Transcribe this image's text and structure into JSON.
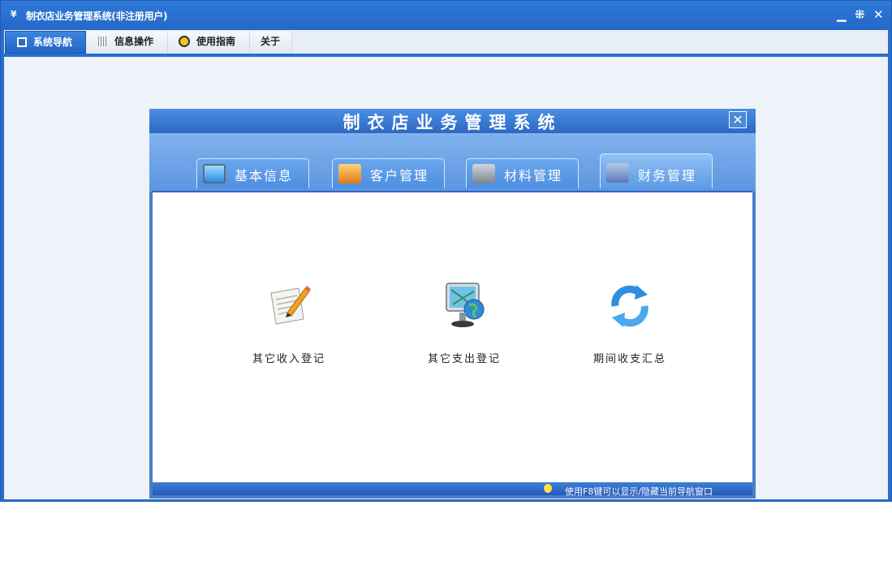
{
  "window": {
    "title": "制衣店业务管理系统(非注册用户)",
    "controls": {
      "minimize": "▁",
      "restore": "⁜",
      "close": "✕"
    }
  },
  "menu_tabs": [
    {
      "label": "系统导航",
      "icon": "monitor-icon",
      "active": true
    },
    {
      "label": "信息操作",
      "icon": "grid-icon",
      "active": false
    },
    {
      "label": "使用指南",
      "icon": "guide-icon",
      "active": false
    },
    {
      "label": "关于",
      "icon": "",
      "active": false
    }
  ],
  "nav_panel": {
    "title": "制衣店业务管理系统",
    "close_glyph": "✕",
    "tabs": [
      {
        "label": "基本信息",
        "icon": "computer-icon",
        "active": false
      },
      {
        "label": "客户管理",
        "icon": "rss-folder-icon",
        "active": false
      },
      {
        "label": "材料管理",
        "icon": "pencil-folder-icon",
        "active": false
      },
      {
        "label": "财务管理",
        "icon": "finance-folder-icon",
        "active": true
      }
    ],
    "functions": [
      {
        "label": "其它收入登记",
        "icon": "notepad-pencil-icon"
      },
      {
        "label": "其它支出登记",
        "icon": "map-globe-icon"
      },
      {
        "label": "期间收支汇总",
        "icon": "refresh-arrows-icon"
      }
    ],
    "status_text": "使用F8键可以显示/隐藏当前导航窗口"
  },
  "colors": {
    "titlebar": "#2a6fd0",
    "client_bg": "#edf3f9",
    "active_tab": "#2463c2",
    "panel_tabs_bg": "#6fa6ea"
  }
}
